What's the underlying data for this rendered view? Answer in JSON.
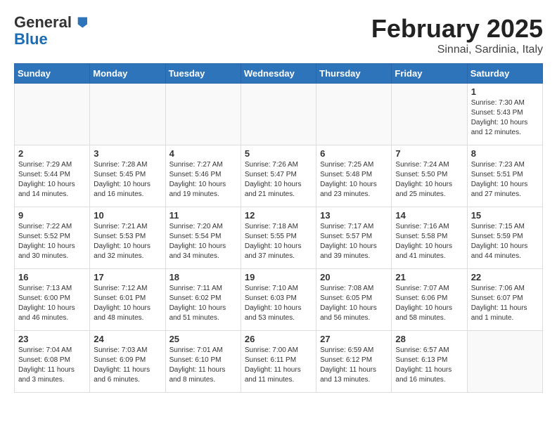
{
  "header": {
    "logo_general": "General",
    "logo_blue": "Blue",
    "cal_title": "February 2025",
    "cal_subtitle": "Sinnai, Sardinia, Italy"
  },
  "days_of_week": [
    "Sunday",
    "Monday",
    "Tuesday",
    "Wednesday",
    "Thursday",
    "Friday",
    "Saturday"
  ],
  "weeks": [
    [
      {
        "day": "",
        "info": ""
      },
      {
        "day": "",
        "info": ""
      },
      {
        "day": "",
        "info": ""
      },
      {
        "day": "",
        "info": ""
      },
      {
        "day": "",
        "info": ""
      },
      {
        "day": "",
        "info": ""
      },
      {
        "day": "1",
        "info": "Sunrise: 7:30 AM\nSunset: 5:43 PM\nDaylight: 10 hours and 12 minutes."
      }
    ],
    [
      {
        "day": "2",
        "info": "Sunrise: 7:29 AM\nSunset: 5:44 PM\nDaylight: 10 hours and 14 minutes."
      },
      {
        "day": "3",
        "info": "Sunrise: 7:28 AM\nSunset: 5:45 PM\nDaylight: 10 hours and 16 minutes."
      },
      {
        "day": "4",
        "info": "Sunrise: 7:27 AM\nSunset: 5:46 PM\nDaylight: 10 hours and 19 minutes."
      },
      {
        "day": "5",
        "info": "Sunrise: 7:26 AM\nSunset: 5:47 PM\nDaylight: 10 hours and 21 minutes."
      },
      {
        "day": "6",
        "info": "Sunrise: 7:25 AM\nSunset: 5:48 PM\nDaylight: 10 hours and 23 minutes."
      },
      {
        "day": "7",
        "info": "Sunrise: 7:24 AM\nSunset: 5:50 PM\nDaylight: 10 hours and 25 minutes."
      },
      {
        "day": "8",
        "info": "Sunrise: 7:23 AM\nSunset: 5:51 PM\nDaylight: 10 hours and 27 minutes."
      }
    ],
    [
      {
        "day": "9",
        "info": "Sunrise: 7:22 AM\nSunset: 5:52 PM\nDaylight: 10 hours and 30 minutes."
      },
      {
        "day": "10",
        "info": "Sunrise: 7:21 AM\nSunset: 5:53 PM\nDaylight: 10 hours and 32 minutes."
      },
      {
        "day": "11",
        "info": "Sunrise: 7:20 AM\nSunset: 5:54 PM\nDaylight: 10 hours and 34 minutes."
      },
      {
        "day": "12",
        "info": "Sunrise: 7:18 AM\nSunset: 5:55 PM\nDaylight: 10 hours and 37 minutes."
      },
      {
        "day": "13",
        "info": "Sunrise: 7:17 AM\nSunset: 5:57 PM\nDaylight: 10 hours and 39 minutes."
      },
      {
        "day": "14",
        "info": "Sunrise: 7:16 AM\nSunset: 5:58 PM\nDaylight: 10 hours and 41 minutes."
      },
      {
        "day": "15",
        "info": "Sunrise: 7:15 AM\nSunset: 5:59 PM\nDaylight: 10 hours and 44 minutes."
      }
    ],
    [
      {
        "day": "16",
        "info": "Sunrise: 7:13 AM\nSunset: 6:00 PM\nDaylight: 10 hours and 46 minutes."
      },
      {
        "day": "17",
        "info": "Sunrise: 7:12 AM\nSunset: 6:01 PM\nDaylight: 10 hours and 48 minutes."
      },
      {
        "day": "18",
        "info": "Sunrise: 7:11 AM\nSunset: 6:02 PM\nDaylight: 10 hours and 51 minutes."
      },
      {
        "day": "19",
        "info": "Sunrise: 7:10 AM\nSunset: 6:03 PM\nDaylight: 10 hours and 53 minutes."
      },
      {
        "day": "20",
        "info": "Sunrise: 7:08 AM\nSunset: 6:05 PM\nDaylight: 10 hours and 56 minutes."
      },
      {
        "day": "21",
        "info": "Sunrise: 7:07 AM\nSunset: 6:06 PM\nDaylight: 10 hours and 58 minutes."
      },
      {
        "day": "22",
        "info": "Sunrise: 7:06 AM\nSunset: 6:07 PM\nDaylight: 11 hours and 1 minute."
      }
    ],
    [
      {
        "day": "23",
        "info": "Sunrise: 7:04 AM\nSunset: 6:08 PM\nDaylight: 11 hours and 3 minutes."
      },
      {
        "day": "24",
        "info": "Sunrise: 7:03 AM\nSunset: 6:09 PM\nDaylight: 11 hours and 6 minutes."
      },
      {
        "day": "25",
        "info": "Sunrise: 7:01 AM\nSunset: 6:10 PM\nDaylight: 11 hours and 8 minutes."
      },
      {
        "day": "26",
        "info": "Sunrise: 7:00 AM\nSunset: 6:11 PM\nDaylight: 11 hours and 11 minutes."
      },
      {
        "day": "27",
        "info": "Sunrise: 6:59 AM\nSunset: 6:12 PM\nDaylight: 11 hours and 13 minutes."
      },
      {
        "day": "28",
        "info": "Sunrise: 6:57 AM\nSunset: 6:13 PM\nDaylight: 11 hours and 16 minutes."
      },
      {
        "day": "",
        "info": ""
      }
    ]
  ]
}
